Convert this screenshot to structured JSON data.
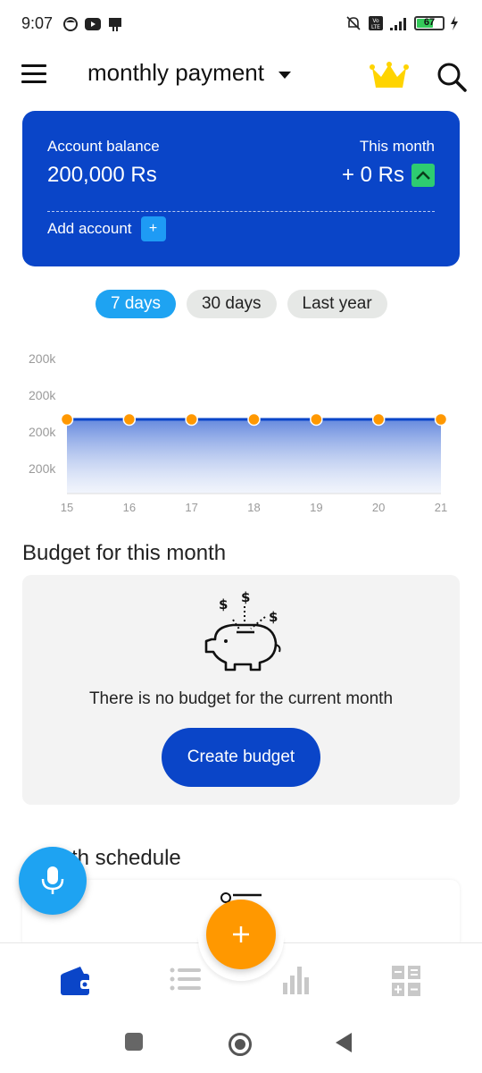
{
  "status_bar": {
    "time": "9:07",
    "battery": "67"
  },
  "app_bar": {
    "title": "monthly payment"
  },
  "balance_card": {
    "account_balance_label": "Account balance",
    "account_balance_value": "200,000 Rs",
    "this_month_label": "This month",
    "this_month_value": "+ 0 Rs",
    "add_account_label": "Add account",
    "add_account_symbol": "+"
  },
  "range_chips": [
    {
      "label": "7 days",
      "active": true
    },
    {
      "label": "30 days",
      "active": false
    },
    {
      "label": "Last year",
      "active": false
    }
  ],
  "chart_data": {
    "type": "area",
    "x": [
      "15",
      "16",
      "17",
      "18",
      "19",
      "20",
      "21"
    ],
    "series": [
      {
        "values": [
          200000,
          200000,
          200000,
          200000,
          200000,
          200000,
          200000
        ]
      }
    ],
    "y_tick_labels": [
      "200k",
      "200k",
      "200k",
      "200k"
    ],
    "title": "",
    "xlabel": "",
    "ylabel": "",
    "grid": false,
    "line_color": "#0a45c8",
    "point_color": "#ff9800"
  },
  "budget": {
    "title": "Budget for this month",
    "empty_text": "There is no budget for the current month",
    "create_button": "Create budget"
  },
  "schedule": {
    "title_visible": "th schedule"
  },
  "colors": {
    "primary": "#0a45c8",
    "accent_blue": "#1ea3f2",
    "fab_orange": "#ff9800",
    "up_green": "#2ecc71",
    "crown_yellow": "#ffd400"
  },
  "icons": {
    "menu": "hamburger-menu-icon",
    "crown": "crown-icon",
    "search": "search-icon",
    "mic": "microphone-icon",
    "add": "plus-icon",
    "wallet": "wallet-icon",
    "list": "list-icon",
    "stats": "bar-chart-icon",
    "calc": "calculator-icon"
  }
}
